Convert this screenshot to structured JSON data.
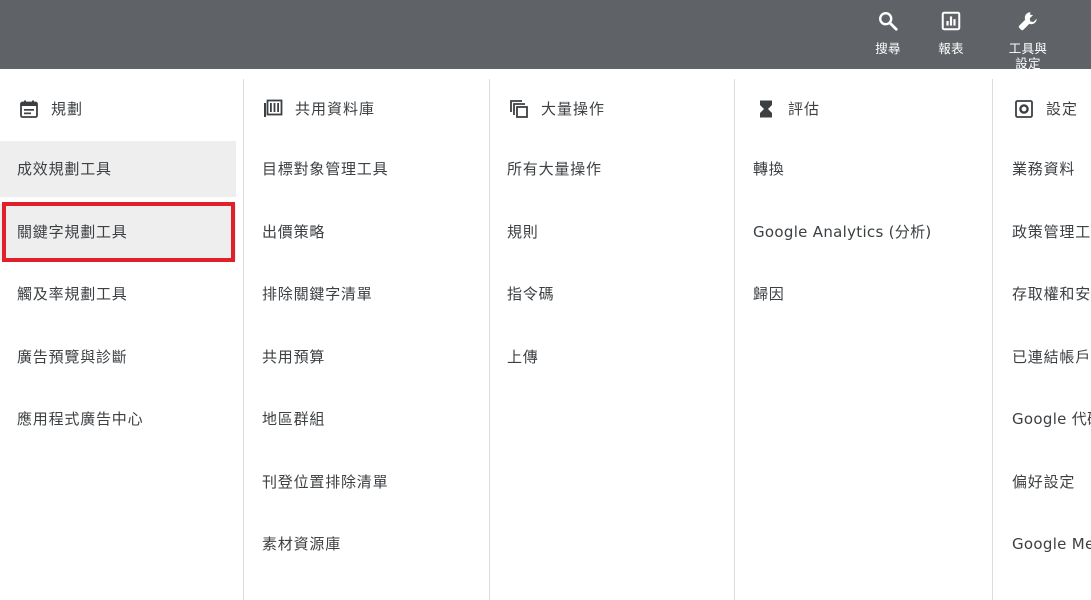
{
  "toolbar": {
    "search_label": "搜尋",
    "reports_label": "報表",
    "settings_label": "工具與設定"
  },
  "columns": {
    "planning": {
      "header": "規劃",
      "items": [
        "成效規劃工具",
        "關鍵字規劃工具",
        "觸及率規劃工具",
        "廣告預覽與診斷",
        "應用程式廣告中心"
      ]
    },
    "shared": {
      "header": "共用資料庫",
      "items": [
        "目標對象管理工具",
        "出價策略",
        "排除關鍵字清單",
        "共用預算",
        "地區群組",
        "刊登位置排除清單",
        "素材資源庫"
      ]
    },
    "bulk": {
      "header": "大量操作",
      "items": [
        "所有大量操作",
        "規則",
        "指令碼",
        "上傳"
      ]
    },
    "measurement": {
      "header": "評估",
      "items": [
        "轉換",
        "Google Analytics (分析)",
        "歸因"
      ]
    },
    "setup": {
      "header": "設定",
      "items": [
        "業務資料",
        "政策管理工具",
        "存取權和安全性",
        "已連結帳戶",
        "Google 代碼",
        "偏好設定",
        "Google Merchant Center"
      ]
    }
  },
  "colors": {
    "topbar": "#5f6368",
    "highlight": "#e0202a",
    "selected_bg": "#eeeeee",
    "divider": "#dadce0"
  }
}
